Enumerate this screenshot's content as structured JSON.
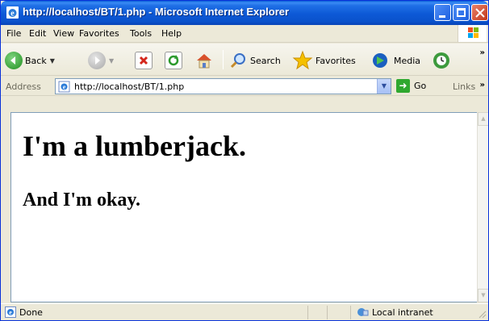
{
  "window": {
    "title": "http://localhost/BT/1.php - Microsoft Internet Explorer"
  },
  "menu": {
    "items": [
      {
        "label": "File"
      },
      {
        "label": "Edit"
      },
      {
        "label": "View"
      },
      {
        "label": "Favorites"
      },
      {
        "label": "Tools"
      },
      {
        "label": "Help"
      }
    ]
  },
  "toolbar": {
    "back_label": "Back",
    "search_label": "Search",
    "favorites_label": "Favorites",
    "media_label": "Media"
  },
  "address": {
    "label": "Address",
    "url": "http://localhost/BT/1.php",
    "go_label": "Go",
    "links_label": "Links"
  },
  "page": {
    "heading": "I'm a lumberjack.",
    "subheading": "And I'm okay."
  },
  "status": {
    "text": "Done",
    "zone": "Local intranet"
  },
  "colors": {
    "titlebar": "#0a52cc",
    "chrome": "#ece9d8"
  }
}
